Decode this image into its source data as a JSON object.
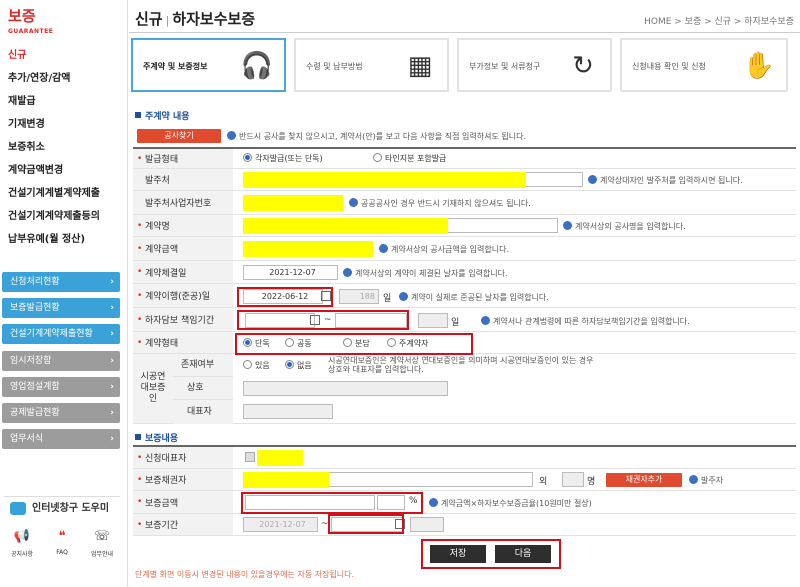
{
  "brand": {
    "title": "보증",
    "subtitle": "GUARANTEE"
  },
  "sidebar": {
    "items": [
      "신규",
      "추가/연장/감액",
      "재발급",
      "기재변경",
      "보증취소",
      "계약금액변경",
      "건설기계계별계약제출",
      "건설기계계약제출등의",
      "납부유예(월 정산)"
    ],
    "blue_items": [
      "신청처리현황",
      "보증발급현황",
      "건설기계계약제출현황"
    ],
    "gray_items": [
      "임시저장함",
      "영업점설계함",
      "공제발급현황",
      "업무서식"
    ],
    "helper": "인터넷창구 도우미",
    "bottom_icons": [
      "공지사항",
      "FAQ",
      "업무안내"
    ]
  },
  "header": {
    "title_main": "신규",
    "title_sub": "하자보수보증",
    "breadcrumb": "HOME > 보증 > 신규 > 하자보수보증"
  },
  "steps": [
    "주계약 및 보증정보",
    "수령 및 납부방법",
    "부가정보 및 서류청구",
    "신청내용 확인 및 신청"
  ],
  "section1": {
    "title": "주계약 내용",
    "search_button": "공사찾기",
    "search_note": "반드시 공사를 찾지 않으시고, 계약서(안)를 보고 다음 사항을 직접 입력하셔도 됩니다.",
    "rows": {
      "issue_type": {
        "label": "발급형태",
        "opt1": "각자발급(또는 단독)",
        "opt2": "타인지분 포함발급"
      },
      "orderer": {
        "label": "발주처",
        "note": "계약상대자인 발주처를 입력하시면 됩니다."
      },
      "orderer_bizno": {
        "label": "발주처사업자번호",
        "note": "공공공사인 경우 반드시 기재하지 않으셔도 됩니다."
      },
      "contract_name": {
        "label": "계약명",
        "note": "계약서상의 공사명을 입력합니다."
      },
      "contract_amount": {
        "label": "계약금액",
        "note": "계약서상의 공사금액을 입력합니다."
      },
      "contract_date": {
        "label": "계약체결일",
        "value": "2021-12-07",
        "note": "계약서상의 계약이 체결된 날자를 입력합니다."
      },
      "completion_date": {
        "label": "계약이행(준공)일",
        "value": "2022-06-12",
        "days": "188",
        "unit": "일",
        "note": "계약이 실제로 준공된 날자를 입력합니다."
      },
      "warranty_period": {
        "label": "하자담보 책임기간",
        "tilde": "~",
        "unit": "일",
        "note": "계약서나 관계법령에 따른 하자담보책임기간을 입력합니다."
      },
      "contract_form": {
        "label": "계약형태",
        "opts": [
          "단독",
          "공동",
          "분담",
          "주계약자"
        ]
      },
      "joint": {
        "group_label": "시공연대보증인",
        "exists": {
          "label": "존재여부",
          "opt1": "있음",
          "opt2": "없음",
          "note1": "시공연대보증인은 계약서상 연대보증인을 의미하며 시공연대보증인이 있는 경우",
          "note2": "상호와 대표자를 입력합니다."
        },
        "company": {
          "label": "상호"
        },
        "ceo": {
          "label": "대표자"
        }
      }
    }
  },
  "section2": {
    "title": "보증내용",
    "rows": {
      "applicant": {
        "label": "신청대표자"
      },
      "creditor": {
        "label": "보증채권자",
        "extra": "외",
        "unit": "명",
        "button": "채권자추가",
        "note": "발주자"
      },
      "amount": {
        "label": "보증금액",
        "pct": "%",
        "note": "계약금액×하자보수보증금율(10원미만 절상)"
      },
      "period": {
        "label": "보증기간",
        "from": "2021-12-07",
        "tilde": "~"
      }
    }
  },
  "buttons": {
    "save": "저장",
    "next": "다음"
  },
  "footnote": "단계별 화면 이동시 변경된 내용이 있을경우에는 자동 저장됩니다.",
  "colors": {
    "accent": "#d92b2b",
    "highlight": "#ffff00",
    "redbox": "#d0101a",
    "blue": "#3aa2d9"
  }
}
